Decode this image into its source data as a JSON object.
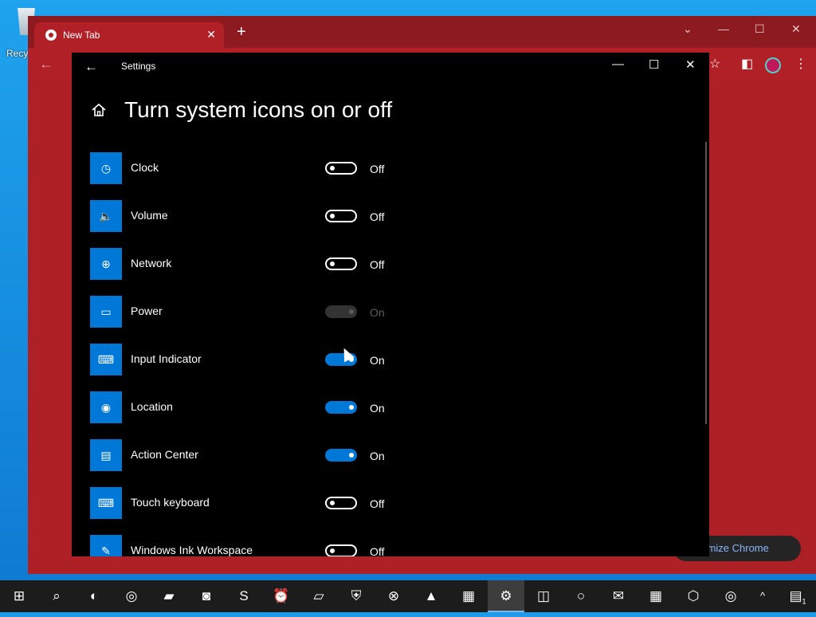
{
  "desktop": {
    "recycle_label": "Recy"
  },
  "chrome": {
    "tab_title": "New Tab",
    "tab_close": "✕",
    "new_tab": "+",
    "customize_label": "ustomize Chrome"
  },
  "settings": {
    "app_title": "Settings",
    "back_glyph": "←",
    "minimize_glyph": "—",
    "maximize_glyph": "☐",
    "close_glyph": "✕",
    "page_title": "Turn system icons on or off",
    "items": [
      {
        "label": "Clock",
        "state": "Off",
        "icon": "clock-icon",
        "glyph": "◷"
      },
      {
        "label": "Volume",
        "state": "Off",
        "icon": "volume-icon",
        "glyph": "🔈"
      },
      {
        "label": "Network",
        "state": "Off",
        "icon": "network-icon",
        "glyph": "⊕"
      },
      {
        "label": "Power",
        "state": "On",
        "icon": "battery-icon",
        "glyph": "▭",
        "disabled": true
      },
      {
        "label": "Input Indicator",
        "state": "On",
        "icon": "keyboard-icon",
        "glyph": "⌨"
      },
      {
        "label": "Location",
        "state": "On",
        "icon": "location-icon",
        "glyph": "◉"
      },
      {
        "label": "Action Center",
        "state": "On",
        "icon": "action-center-icon",
        "glyph": "▤"
      },
      {
        "label": "Touch keyboard",
        "state": "Off",
        "icon": "touch-keyboard-icon",
        "glyph": "⌨"
      },
      {
        "label": "Windows Ink Workspace",
        "state": "Off",
        "icon": "pen-icon",
        "glyph": "✎"
      }
    ],
    "accent_color": "#0078d7"
  },
  "taskbar": {
    "items": [
      {
        "name": "start-icon",
        "glyph": "⊞"
      },
      {
        "name": "search-icon",
        "glyph": "⌕"
      },
      {
        "name": "firefox-icon",
        "glyph": "◐"
      },
      {
        "name": "chrome-icon",
        "glyph": "◎"
      },
      {
        "name": "file-explorer-icon",
        "glyph": "▰"
      },
      {
        "name": "camera-icon",
        "glyph": "◙"
      },
      {
        "name": "skype-icon",
        "glyph": "S"
      },
      {
        "name": "alarm-clock-icon",
        "glyph": "⏰"
      },
      {
        "name": "app-icon",
        "glyph": "▱"
      },
      {
        "name": "security-icon",
        "glyph": "⛨"
      },
      {
        "name": "xbox-icon",
        "glyph": "⊗"
      },
      {
        "name": "photos-icon",
        "glyph": "▲"
      },
      {
        "name": "movies-icon",
        "glyph": "▦"
      },
      {
        "name": "settings-icon",
        "glyph": "⚙"
      },
      {
        "name": "store-icon",
        "glyph": "◫"
      },
      {
        "name": "cortana-icon",
        "glyph": "○"
      },
      {
        "name": "mail-icon",
        "glyph": "✉"
      },
      {
        "name": "calculator-icon",
        "glyph": "▦"
      },
      {
        "name": "3d-viewer-icon",
        "glyph": "⬡"
      },
      {
        "name": "chrome-icon-2",
        "glyph": "◎"
      }
    ],
    "tray_chevron": "^",
    "notification_badge": "1"
  }
}
